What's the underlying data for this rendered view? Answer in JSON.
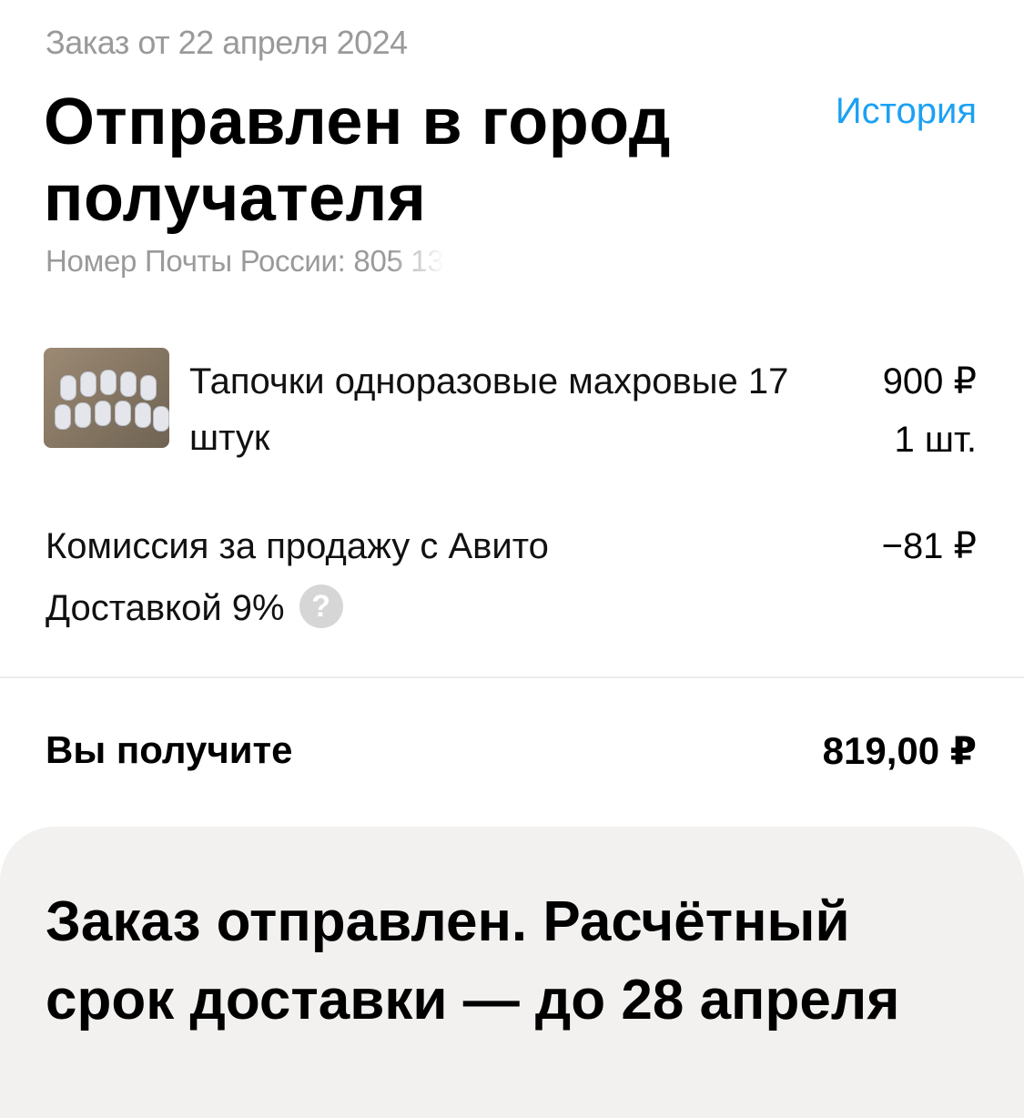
{
  "header": {
    "order_date": "Заказ от 22 апреля 2024",
    "status_title": "Отправлен в город получателя",
    "history_link": "История",
    "tracking_label": "Номер Почты России: ",
    "tracking_visible": "805 13"
  },
  "product": {
    "name": "Тапочки одноразовые махровые 17 штук",
    "price": "900 ₽",
    "quantity": "1 шт."
  },
  "commission": {
    "label": "Комиссия за продажу с Авито Доставкой 9%",
    "value": "−81 ₽",
    "help_glyph": "?"
  },
  "total": {
    "label": "Вы получите",
    "value": "819,00 ₽"
  },
  "info_card": {
    "text": "Заказ отправлен. Расчётный срок доставки — до 28 апреля"
  },
  "colors": {
    "link": "#1ca1f2",
    "secondary_text": "#9a9a9a",
    "card_background": "#f2f1ef"
  }
}
